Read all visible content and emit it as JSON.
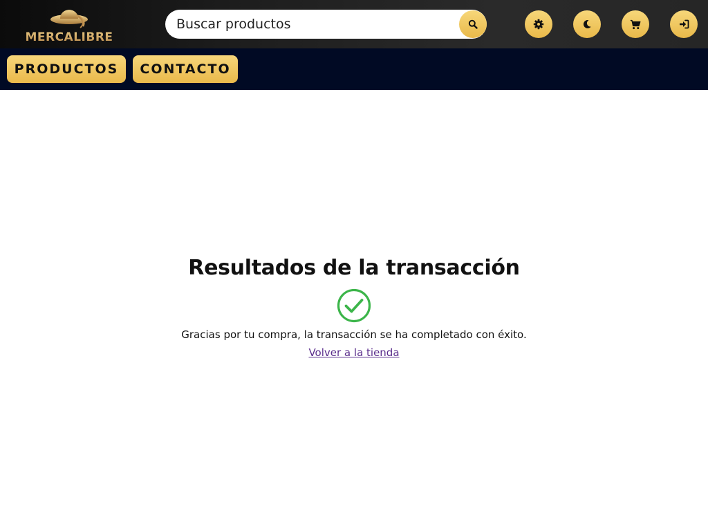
{
  "header": {
    "logo_text": "MERCALIBRE",
    "search": {
      "placeholder": "Buscar productos",
      "value": ""
    },
    "icons": [
      "search-icon",
      "settings-icon",
      "moon-icon",
      "cart-icon",
      "login-icon"
    ]
  },
  "nav": {
    "items": [
      {
        "label": "PRODUCTOS"
      },
      {
        "label": "CONTACTO"
      }
    ]
  },
  "result": {
    "title": "Resultados de la transacción",
    "status_icon": "check-circle-icon",
    "message": "Gracias por tu compra, la transacción se ha completado con éxito.",
    "link_text": "Volver a la tienda"
  },
  "colors": {
    "header_bg": "#1e1e1e",
    "nav_bg": "#010a24",
    "gold": "#f0c75e",
    "success": "#3cb54a",
    "link": "#5a2d8c"
  }
}
